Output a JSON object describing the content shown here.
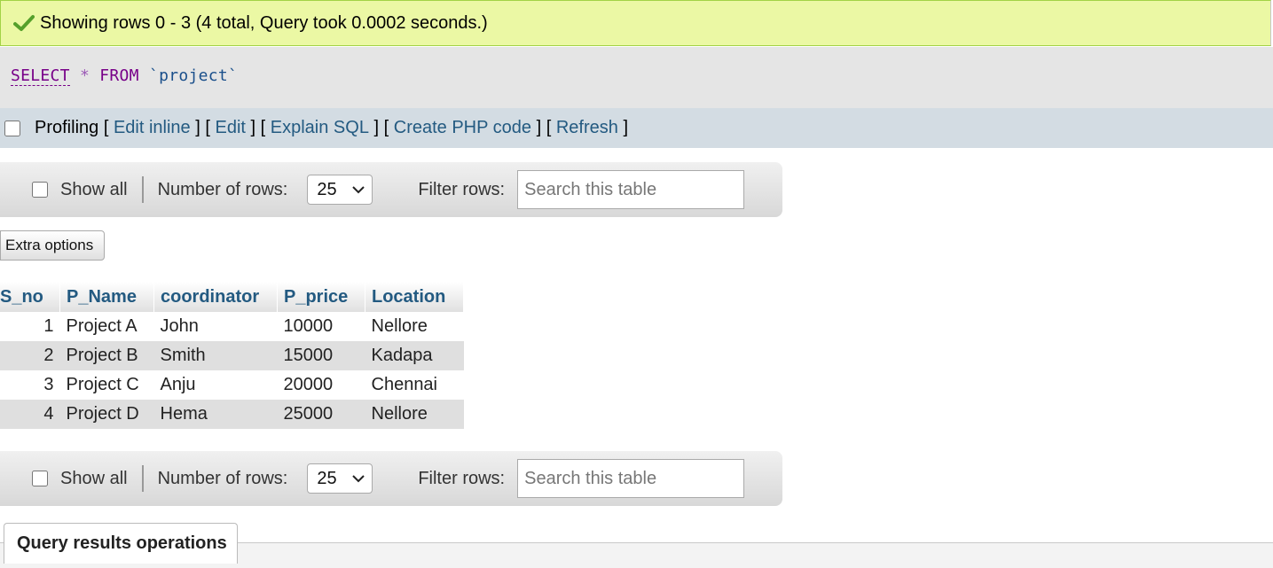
{
  "message": {
    "text": "Showing rows 0 - 3 (4 total, Query took 0.0002 seconds.)",
    "icon": "check-icon",
    "color": "#55a02b"
  },
  "sql": {
    "select": "SELECT",
    "star": "*",
    "from": "FROM",
    "table": "`project`"
  },
  "tools": {
    "profiling": "Profiling",
    "edit_inline": "Edit inline",
    "edit": "Edit",
    "explain": "Explain SQL",
    "php": "Create PHP code",
    "refresh": "Refresh",
    "open": "[",
    "close": "]"
  },
  "nav": {
    "show_all": "Show all",
    "rows_label": "Number of rows:",
    "rows_value": "25",
    "filter_label": "Filter rows:",
    "filter_placeholder": "Search this table"
  },
  "extra_options": "Extra options",
  "table": {
    "headers": [
      "S_no",
      "P_Name",
      "coordinator",
      "P_price",
      "Location"
    ],
    "rows": [
      [
        "1",
        "Project A",
        "John",
        "10000",
        "Nellore"
      ],
      [
        "2",
        "Project B",
        "Smith",
        "15000",
        "Kadapa"
      ],
      [
        "3",
        "Project C",
        "Anju",
        "20000",
        "Chennai"
      ],
      [
        "4",
        "Project D",
        "Hema",
        "25000",
        "Nellore"
      ]
    ]
  },
  "operations": {
    "label": "Query results operations"
  }
}
